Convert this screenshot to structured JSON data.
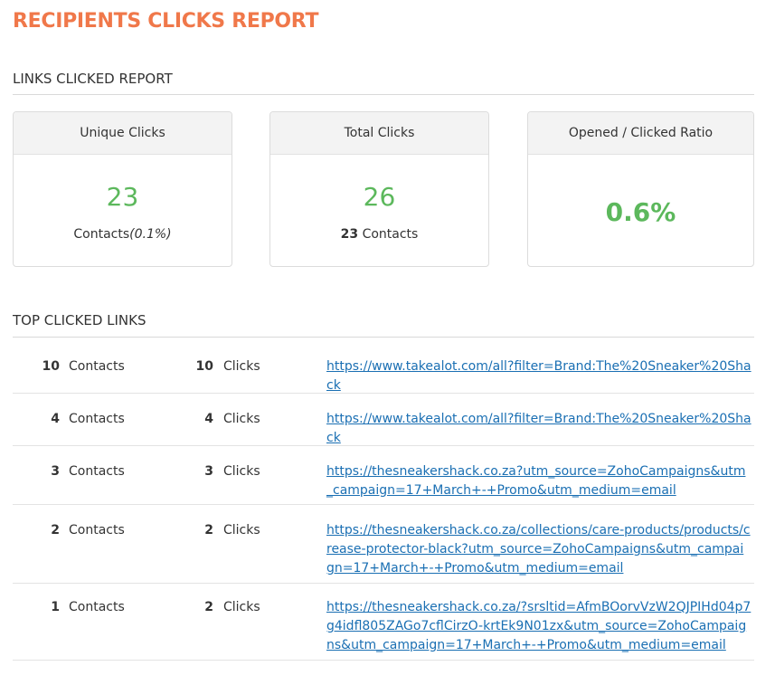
{
  "page_title": "RECIPIENTS CLICKS REPORT",
  "links_section_title": "LINKS CLICKED REPORT",
  "cards": {
    "unique": {
      "header": "Unique Clicks",
      "value": "23",
      "sub_label": "Contacts",
      "sub_pct": "(0.1%)"
    },
    "total": {
      "header": "Total Clicks",
      "value": "26",
      "sub_count": "23",
      "sub_label": "Contacts"
    },
    "ratio": {
      "header": "Opened / Clicked Ratio",
      "value": "0.6%"
    }
  },
  "accent_colors": {
    "title": "#f0784a",
    "value": "#5cb85c",
    "link": "#1a6fb3"
  },
  "top_links_title": "TOP CLICKED LINKS",
  "rows": [
    {
      "contacts": "10",
      "contacts_label": "Contacts",
      "clicks": "10",
      "clicks_label": "Clicks",
      "url": "https://www.takealot.com/all?filter=Brand:The%20Sneaker%20Shack"
    },
    {
      "contacts": "4",
      "contacts_label": "Contacts",
      "clicks": "4",
      "clicks_label": "Clicks",
      "url": "https://www.takealot.com/all?filter=Brand:The%20Sneaker%20Shack"
    },
    {
      "contacts": "3",
      "contacts_label": "Contacts",
      "clicks": "3",
      "clicks_label": "Clicks",
      "url": "https://thesneakershack.co.za?utm_source=ZohoCampaigns&utm_campaign=17+March+-+Promo&utm_medium=email"
    },
    {
      "contacts": "2",
      "contacts_label": "Contacts",
      "clicks": "2",
      "clicks_label": "Clicks",
      "url": "https://thesneakershack.co.za/collections/care-products/products/crease-protector-black?utm_source=ZohoCampaigns&utm_campaign=17+March+-+Promo&utm_medium=email"
    },
    {
      "contacts": "1",
      "contacts_label": "Contacts",
      "clicks": "2",
      "clicks_label": "Clicks",
      "url": "https://thesneakershack.co.za/?srsltid=AfmBOorvVzW2QJPIHd04p7g4idfl805ZAGo7cflCirzO-krtEk9N01zx&utm_source=ZohoCampaigns&utm_campaign=17+March+-+Promo&utm_medium=email"
    }
  ]
}
